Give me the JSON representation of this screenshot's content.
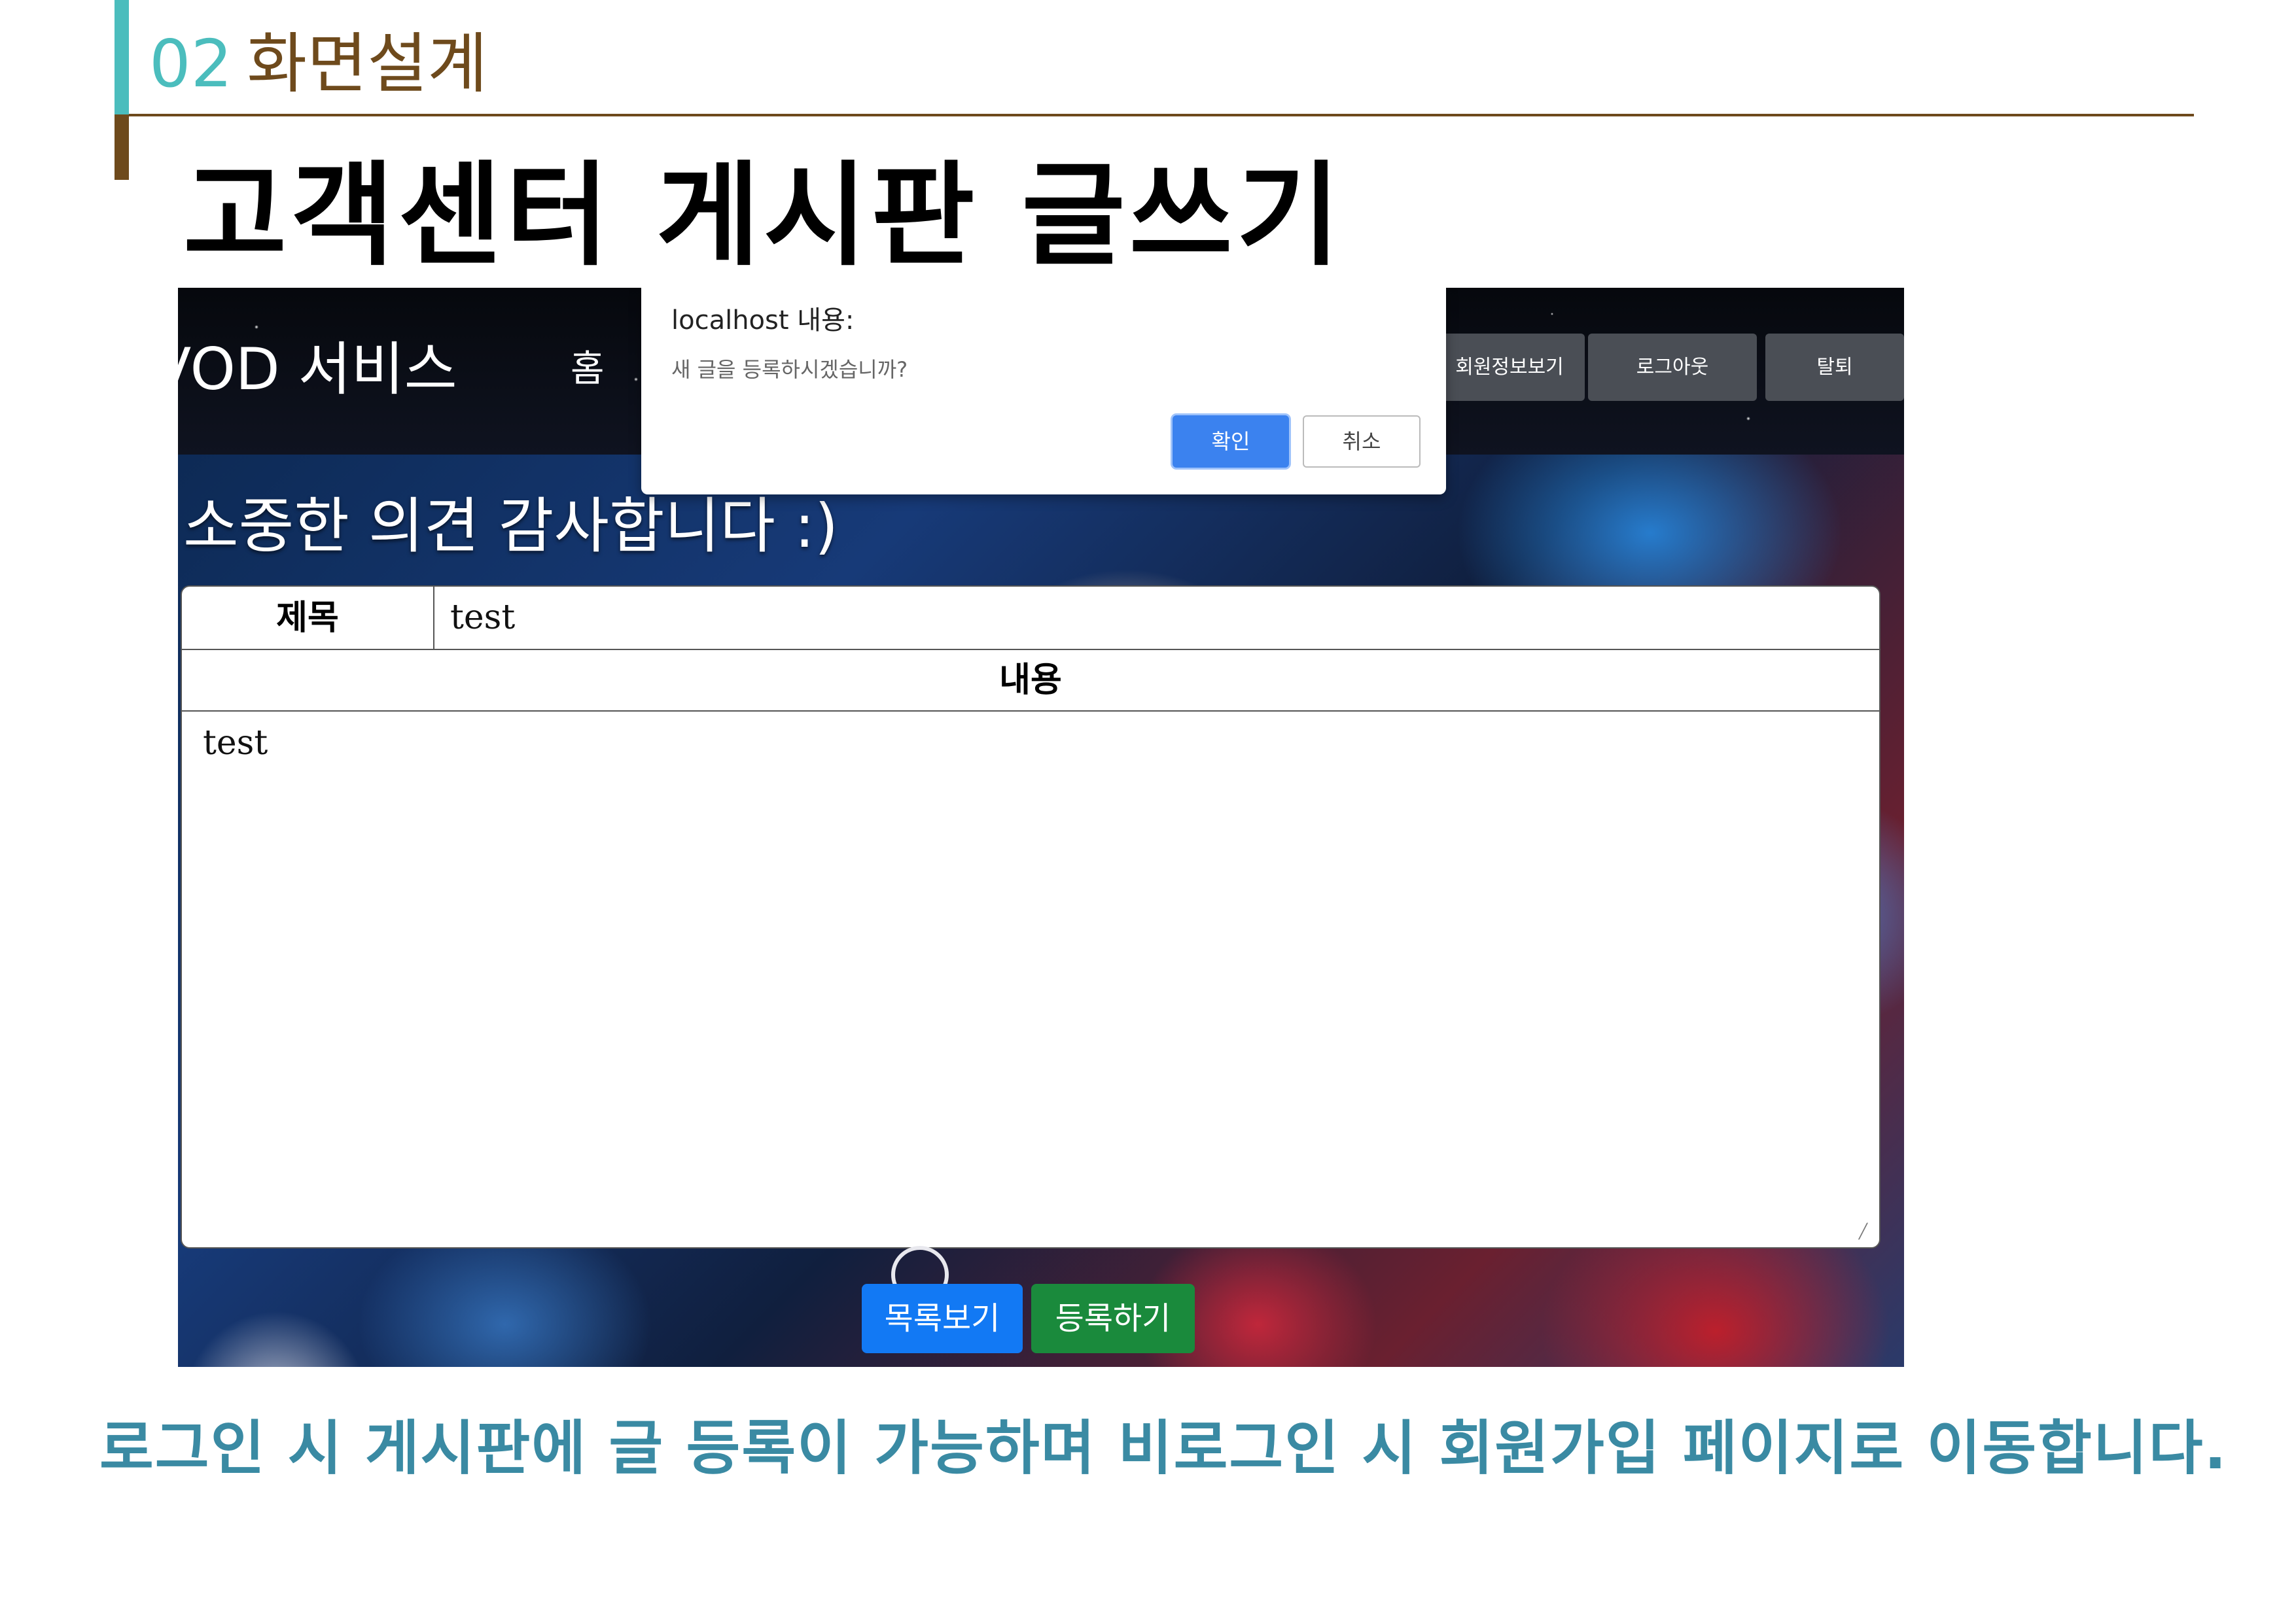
{
  "slide": {
    "section_number": "02",
    "section_title": "화면설계",
    "title": "고객센터 게시판 글쓰기",
    "caption": "로그인 시 게시판에 글 등록이 가능하며 비로그인 시 회원가입 페이지로 이동합니다.",
    "colors": {
      "teal": "#4bbdbd",
      "brown": "#6e4a1c",
      "caption": "#3a8aa3"
    }
  },
  "app": {
    "brand": "VOD 서비스",
    "nav": {
      "home": "홈",
      "member_info": "회원정보보기",
      "logout": "로그아웃",
      "withdraw": "탈퇴"
    },
    "greeting": "소중한 의견 감사합니다 :)",
    "form": {
      "title_label": "제목",
      "title_value": "test",
      "content_label": "내용",
      "content_value": "test"
    },
    "buttons": {
      "list": "목록보기",
      "submit": "등록하기"
    }
  },
  "dialog": {
    "title": "localhost 내용:",
    "message": "새 글을 등록하시겠습니까?",
    "ok": "확인",
    "cancel": "취소"
  }
}
